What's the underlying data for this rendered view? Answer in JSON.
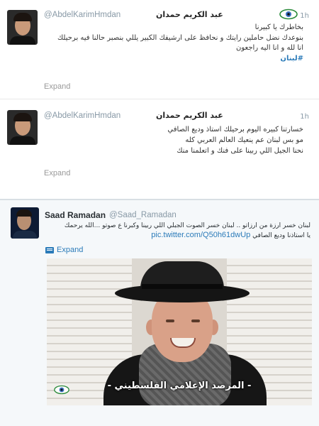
{
  "tweets": [
    {
      "handle": "@AbdelKarimHmdan",
      "name": "عبد الكريم حمدان",
      "time": "1h",
      "lines": [
        "بخاطرك يا كبيرنا",
        "بنوعدك نضل حاملين رايتك و نحافظ على ارشيفك الكبير يللي بنصبر حالنا فيه برحيلك",
        "انا لله و انا اليه راجعون"
      ],
      "hashtag": "#لبنان",
      "expand": "Expand"
    },
    {
      "handle": "@AbdelKarimHmdan",
      "name": "عبد الكريم حمدان",
      "time": "1h",
      "lines": [
        "خسارتنا كبيره اليوم برحيلك استاذ وديع الصافي",
        "مو بس لبنان عم ينعيك العالم العربي كله",
        "نحنا الجيل اللي ربينا على فنك و اتعلمنا منك"
      ],
      "expand": "Expand"
    }
  ],
  "featured_tweet": {
    "name": "Saad Ramadan",
    "handle": "@Saad_Ramadan",
    "line1": "لبنان خسر ارزة من ارزاتو .. لبنان خسر الصوت الجبلي اللي ربينا وكبرنا ع صوتو ...الله يرحمك",
    "line2_text": "يا استاذنا وديع الصافي",
    "pic_link": "pic.twitter.com/Q50h61dwUp",
    "expand": "Expand",
    "caption": "- المرصد الإعلامي الفلسطيني -"
  },
  "colors": {
    "link": "#2b7bb9",
    "muted": "#8899a6",
    "hashtag": "#2b7bb9"
  },
  "icons": {
    "watermark": "eye-icon",
    "expand": "expand-icon"
  }
}
